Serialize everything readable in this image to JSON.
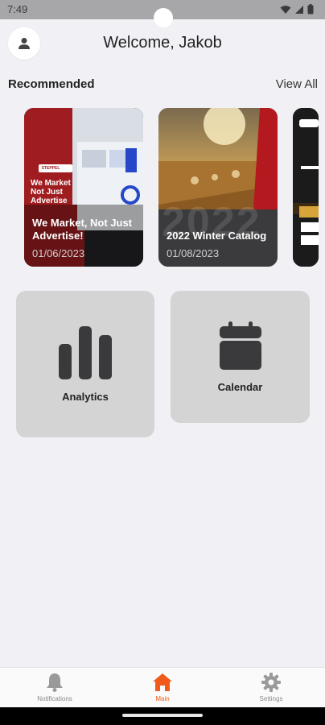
{
  "status_bar": {
    "time": "7:49"
  },
  "header": {
    "welcome": "Welcome, Jakob"
  },
  "recommended": {
    "section_title": "Recommended",
    "view_all_label": "View All",
    "cards": [
      {
        "title": "We Market, Not Just Advertise!",
        "date": "01/06/2023",
        "overlay_text": "We Market\nNot Just Advertise",
        "brand": "STEPPEL"
      },
      {
        "title": "2022 Winter Catalog",
        "date": "01/08/2023",
        "overlay_text": "2022"
      },
      {
        "title": "",
        "date": ""
      }
    ]
  },
  "tiles": {
    "analytics_label": "Analytics",
    "calendar_label": "Calendar"
  },
  "bottom_nav": {
    "notifications_label": "Notifications",
    "main_label": "Main",
    "settings_label": "Settings",
    "active": "Main",
    "active_color": "#f05a1a"
  },
  "colors": {
    "background": "#f1f0f5",
    "tile": "#d4d4d4",
    "accent": "#f05a1a"
  }
}
